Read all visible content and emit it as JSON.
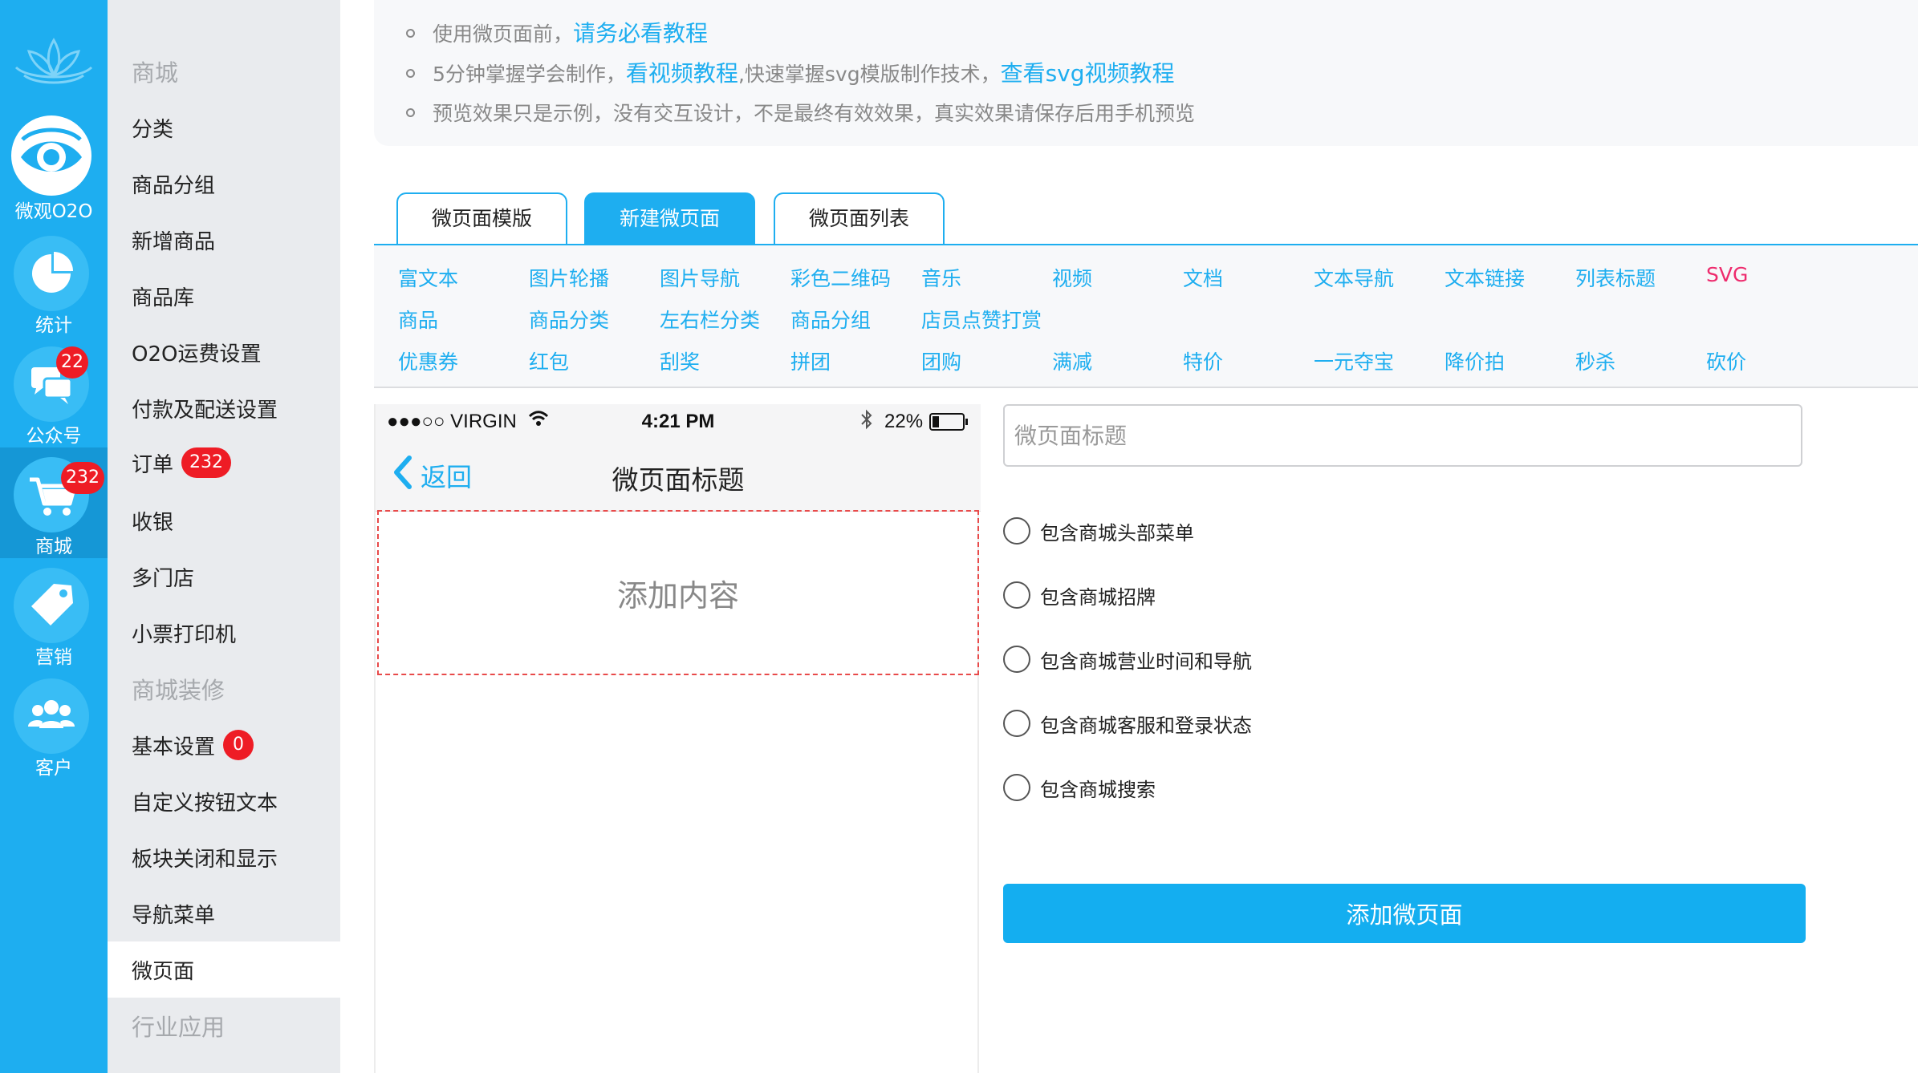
{
  "rail": {
    "logo_icon": "lotus-logo-icon",
    "items": [
      {
        "label": "微观O2O",
        "icon": "eye-icon",
        "badge": ""
      },
      {
        "label": "统计",
        "icon": "pie-chart-icon",
        "badge": ""
      },
      {
        "label": "公众号",
        "icon": "chat-bubbles-icon",
        "badge": "22"
      },
      {
        "label": "商城",
        "icon": "cart-icon",
        "badge": "232"
      },
      {
        "label": "营销",
        "icon": "price-tag-icon",
        "badge": ""
      },
      {
        "label": "客户",
        "icon": "people-icon",
        "badge": ""
      }
    ],
    "active": "商城",
    "color": "#1eaef0"
  },
  "menu": {
    "items": [
      {
        "label": "商城",
        "type": "header",
        "badge": ""
      },
      {
        "label": "分类",
        "type": "item",
        "badge": ""
      },
      {
        "label": "商品分组",
        "type": "item",
        "badge": ""
      },
      {
        "label": "新增商品",
        "type": "item",
        "badge": ""
      },
      {
        "label": "商品库",
        "type": "item",
        "badge": ""
      },
      {
        "label": "O2O运费设置",
        "type": "item",
        "badge": ""
      },
      {
        "label": "付款及配送设置",
        "type": "item",
        "badge": ""
      },
      {
        "label": "订单",
        "type": "item",
        "badge": "232"
      },
      {
        "label": "收银",
        "type": "item",
        "badge": ""
      },
      {
        "label": "多门店",
        "type": "item",
        "badge": ""
      },
      {
        "label": "小票打印机",
        "type": "item",
        "badge": ""
      },
      {
        "label": "商城装修",
        "type": "header",
        "badge": ""
      },
      {
        "label": "基本设置",
        "type": "item",
        "badge": "0"
      },
      {
        "label": "自定义按钮文本",
        "type": "item",
        "badge": ""
      },
      {
        "label": "板块关闭和显示",
        "type": "item",
        "badge": ""
      },
      {
        "label": "导航菜单",
        "type": "item",
        "badge": ""
      },
      {
        "label": "微页面",
        "type": "item",
        "badge": "",
        "active": true
      },
      {
        "label": "行业应用",
        "type": "header",
        "badge": ""
      }
    ]
  },
  "notice": {
    "line1": {
      "text": "使用微页面前，",
      "link": "请务必看教程"
    },
    "line2": {
      "text": "5分钟掌握学会制作，",
      "link1": "看视频教程",
      "mid": ",快速掌握svg模版制作技术，",
      "link2": "查看svg视频教程"
    },
    "line3": {
      "text": "预览效果只是示例，没有交互设计，不是最终有效效果，真实效果请保存后用手机预览"
    }
  },
  "tabs": [
    {
      "label": "微页面模版",
      "active": false
    },
    {
      "label": "新建微页面",
      "active": true
    },
    {
      "label": "微页面列表",
      "active": false
    }
  ],
  "widgets": [
    [
      "富文本",
      "图片轮播",
      "图片导航",
      "彩色二维码",
      "音乐",
      "视频",
      "文档",
      "文本导航",
      "文本链接",
      "列表标题",
      "SVG"
    ],
    [
      "商品",
      "商品分类",
      "左右栏分类",
      "商品分组",
      "店员点赞打赏"
    ],
    [
      "优惠券",
      "红包",
      "刮奖",
      "拼团",
      "团购",
      "满减",
      "特价",
      "一元夺宝",
      "降价拍",
      "秒杀",
      "砍价"
    ]
  ],
  "phone": {
    "carrier": "●●●○○ VIRGIN",
    "time": "4:21 PM",
    "battery": "22%",
    "battery_level": 0.22,
    "back_label": "返回",
    "title": "微页面标题",
    "dropzone_label": "添加内容"
  },
  "form": {
    "title_placeholder": "微页面标题",
    "title_value": "",
    "options": [
      {
        "label": "包含商城头部菜单",
        "checked": false
      },
      {
        "label": "包含商城招牌",
        "checked": false
      },
      {
        "label": "包含商城营业时间和导航",
        "checked": false
      },
      {
        "label": "包含商城客服和登录状态",
        "checked": false
      },
      {
        "label": "包含商城搜索",
        "checked": false
      }
    ],
    "submit_label": "添加微页面"
  }
}
